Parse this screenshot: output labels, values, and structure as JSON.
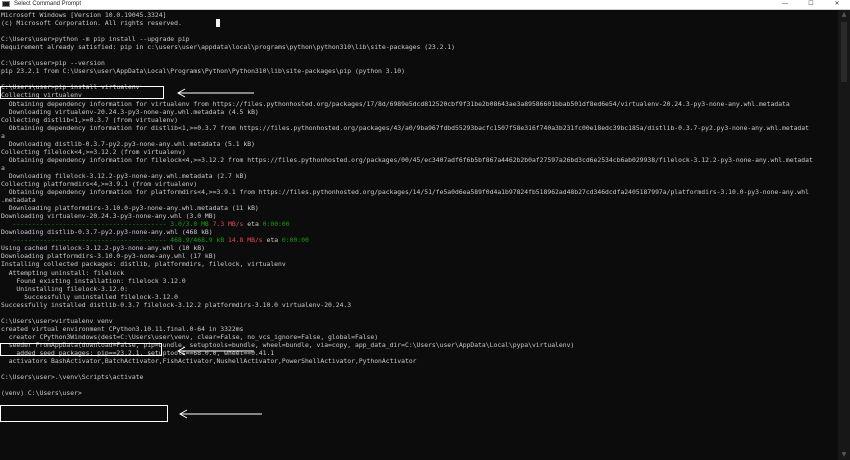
{
  "window": {
    "title": "Select Command Prompt",
    "app_icon": "cmd-icon",
    "controls": {
      "minimize": "—",
      "maximize": "☐",
      "close": "✕"
    }
  },
  "colors": {
    "background": "#0c0c0c",
    "text": "#cccccc",
    "green": "#13a10e",
    "red": "#e74856",
    "white": "#f2f2f2"
  },
  "scrollbar": {
    "up": "▲",
    "down": "▼"
  },
  "console_lines": [
    [
      {
        "t": "Microsoft Windows [Version 10.0.19045.3324]"
      }
    ],
    [
      {
        "t": "(c) Microsoft Corporation. All rights reserved."
      }
    ],
    [
      {
        "t": ""
      }
    ],
    [
      {
        "t": "C:\\Users\\user>python -m pip install --upgrade pip"
      }
    ],
    [
      {
        "t": "Requirement already satisfied: pip in c:\\users\\user\\appdata\\local\\programs\\python\\python310\\lib\\site-packages (23.2.1)"
      }
    ],
    [
      {
        "t": ""
      }
    ],
    [
      {
        "t": "C:\\Users\\user>pip --version"
      }
    ],
    [
      {
        "t": "pip 23.2.1 from C:\\Users\\user\\AppData\\Local\\Programs\\Python\\Python310\\lib\\site-packages\\pip (python 3.10)"
      }
    ],
    [
      {
        "t": ""
      }
    ],
    [
      {
        "t": "C:\\Users\\user>pip install virtualenv"
      }
    ],
    [
      {
        "t": "Collecting virtualenv"
      }
    ],
    [
      {
        "t": "  Obtaining dependency information for virtualenv from https://files.pythonhosted.org/packages/17/8d/6989e5dcd812520cbf9f31be2b08643ae3a89586601bbab501df8ed6e54/virtualenv-20.24.3-py3-none-any.whl.metadata"
      }
    ],
    [
      {
        "t": "  Downloading virtualenv-20.24.3-py3-none-any.whl.metadata (4.5 kB)"
      }
    ],
    [
      {
        "t": "Collecting distlib<1,>=0.3.7 (from virtualenv)"
      }
    ],
    [
      {
        "t": "  Obtaining dependency information for distlib<1,>=0.3.7 from https://files.pythonhosted.org/packages/43/a0/9ba967fdbd55293bacfc1507f58e316f740a3b231fc00e18edc39bc185a/distlib-0.3.7-py2.py3-none-any.whl.metadat"
      }
    ],
    [
      {
        "t": "a"
      }
    ],
    [
      {
        "t": "  Downloading distlib-0.3.7-py2.py3-none-any.whl.metadata (5.1 kB)"
      }
    ],
    [
      {
        "t": "Collecting filelock<4,>=3.12.2 (from virtualenv)"
      }
    ],
    [
      {
        "t": "  Obtaining dependency information for filelock<4,>=3.12.2 from https://files.pythonhosted.org/packages/00/45/ec3407adf6f6b5bf867a4462b2b0af27597a26bd3cd6e2534cb6ab029938/filelock-3.12.2-py3-none-any.whl.metadat"
      }
    ],
    [
      {
        "t": "a"
      }
    ],
    [
      {
        "t": "  Downloading filelock-3.12.2-py3-none-any.whl.metadata (2.7 kB)"
      }
    ],
    [
      {
        "t": "Collecting platformdirs<4,>=3.9.1 (from virtualenv)"
      }
    ],
    [
      {
        "t": "  Obtaining dependency information for platformdirs<4,>=3.9.1 from https://files.pythonhosted.org/packages/14/51/fe5a0d6ea589f0d4a1b97824fb518962ad48b27cd346dcdfa2405187997a/platformdirs-3.10.0-py3-none-any.whl"
      }
    ],
    [
      {
        "t": ".metadata"
      }
    ],
    [
      {
        "t": "  Downloading platformdirs-3.10.0-py3-none-any.whl.metadata (11 kB)"
      }
    ],
    [
      {
        "t": "Downloading virtualenv-20.24.3-py3-none-any.whl (3.0 MB)"
      }
    ],
    [
      {
        "t": "   ---------------------------------------- ",
        "c": "green"
      },
      {
        "t": "3.0/3.0 MB ",
        "c": "green"
      },
      {
        "t": "7.3 MB/s",
        "c": "red"
      },
      {
        "t": " eta "
      },
      {
        "t": "0:00:00",
        "c": "green"
      }
    ],
    [
      {
        "t": "Downloading distlib-0.3.7-py2.py3-none-any.whl (468 kB)"
      }
    ],
    [
      {
        "t": "   ---------------------------------------- ",
        "c": "green"
      },
      {
        "t": "468.9/468.9 kB ",
        "c": "green"
      },
      {
        "t": "14.8 MB/s",
        "c": "red"
      },
      {
        "t": " eta "
      },
      {
        "t": "0:00:00",
        "c": "green"
      }
    ],
    [
      {
        "t": "Using cached filelock-3.12.2-py3-none-any.whl (10 kB)"
      }
    ],
    [
      {
        "t": "Downloading platformdirs-3.10.0-py3-none-any.whl (17 kB)"
      }
    ],
    [
      {
        "t": "Installing collected packages: distlib, platformdirs, filelock, virtualenv"
      }
    ],
    [
      {
        "t": "  Attempting uninstall: filelock"
      }
    ],
    [
      {
        "t": "    Found existing installation: filelock 3.12.0"
      }
    ],
    [
      {
        "t": "    Uninstalling filelock-3.12.0:"
      }
    ],
    [
      {
        "t": "      Successfully uninstalled filelock-3.12.0"
      }
    ],
    [
      {
        "t": "Successfully installed distlib-0.3.7 filelock-3.12.2 platformdirs-3.10.0 virtualenv-20.24.3"
      }
    ],
    [
      {
        "t": ""
      }
    ],
    [
      {
        "t": "C:\\Users\\user>virtualenv venv"
      }
    ],
    [
      {
        "t": "created virtual environment CPython3.10.11.final.0-64 in 3322ms"
      }
    ],
    [
      {
        "t": "  creator CPython3Windows(dest=C:\\Users\\user\\venv, clear=False, no_vcs_ignore=False, global=False)"
      }
    ],
    [
      {
        "t": "  seeder FromAppData(download=False, pip=bundle, setuptools=bundle, wheel=bundle, via=copy, app_data_dir=C:\\Users\\user\\AppData\\Local\\pypa\\virtualenv)"
      }
    ],
    [
      {
        "t": "    added seed packages: pip==23.2.1, setuptools==68.0.0, wheel==0.41.1"
      }
    ],
    [
      {
        "t": "  activators BashActivator,BatchActivator,FishActivator,NushellActivator,PowerShellActivator,PythonActivator"
      }
    ],
    [
      {
        "t": ""
      }
    ],
    [
      {
        "t": "C:\\Users\\user>.\\venv\\Scripts\\activate"
      }
    ],
    [
      {
        "t": ""
      }
    ],
    [
      {
        "t": "(venv) C:\\Users\\user>"
      }
    ]
  ]
}
